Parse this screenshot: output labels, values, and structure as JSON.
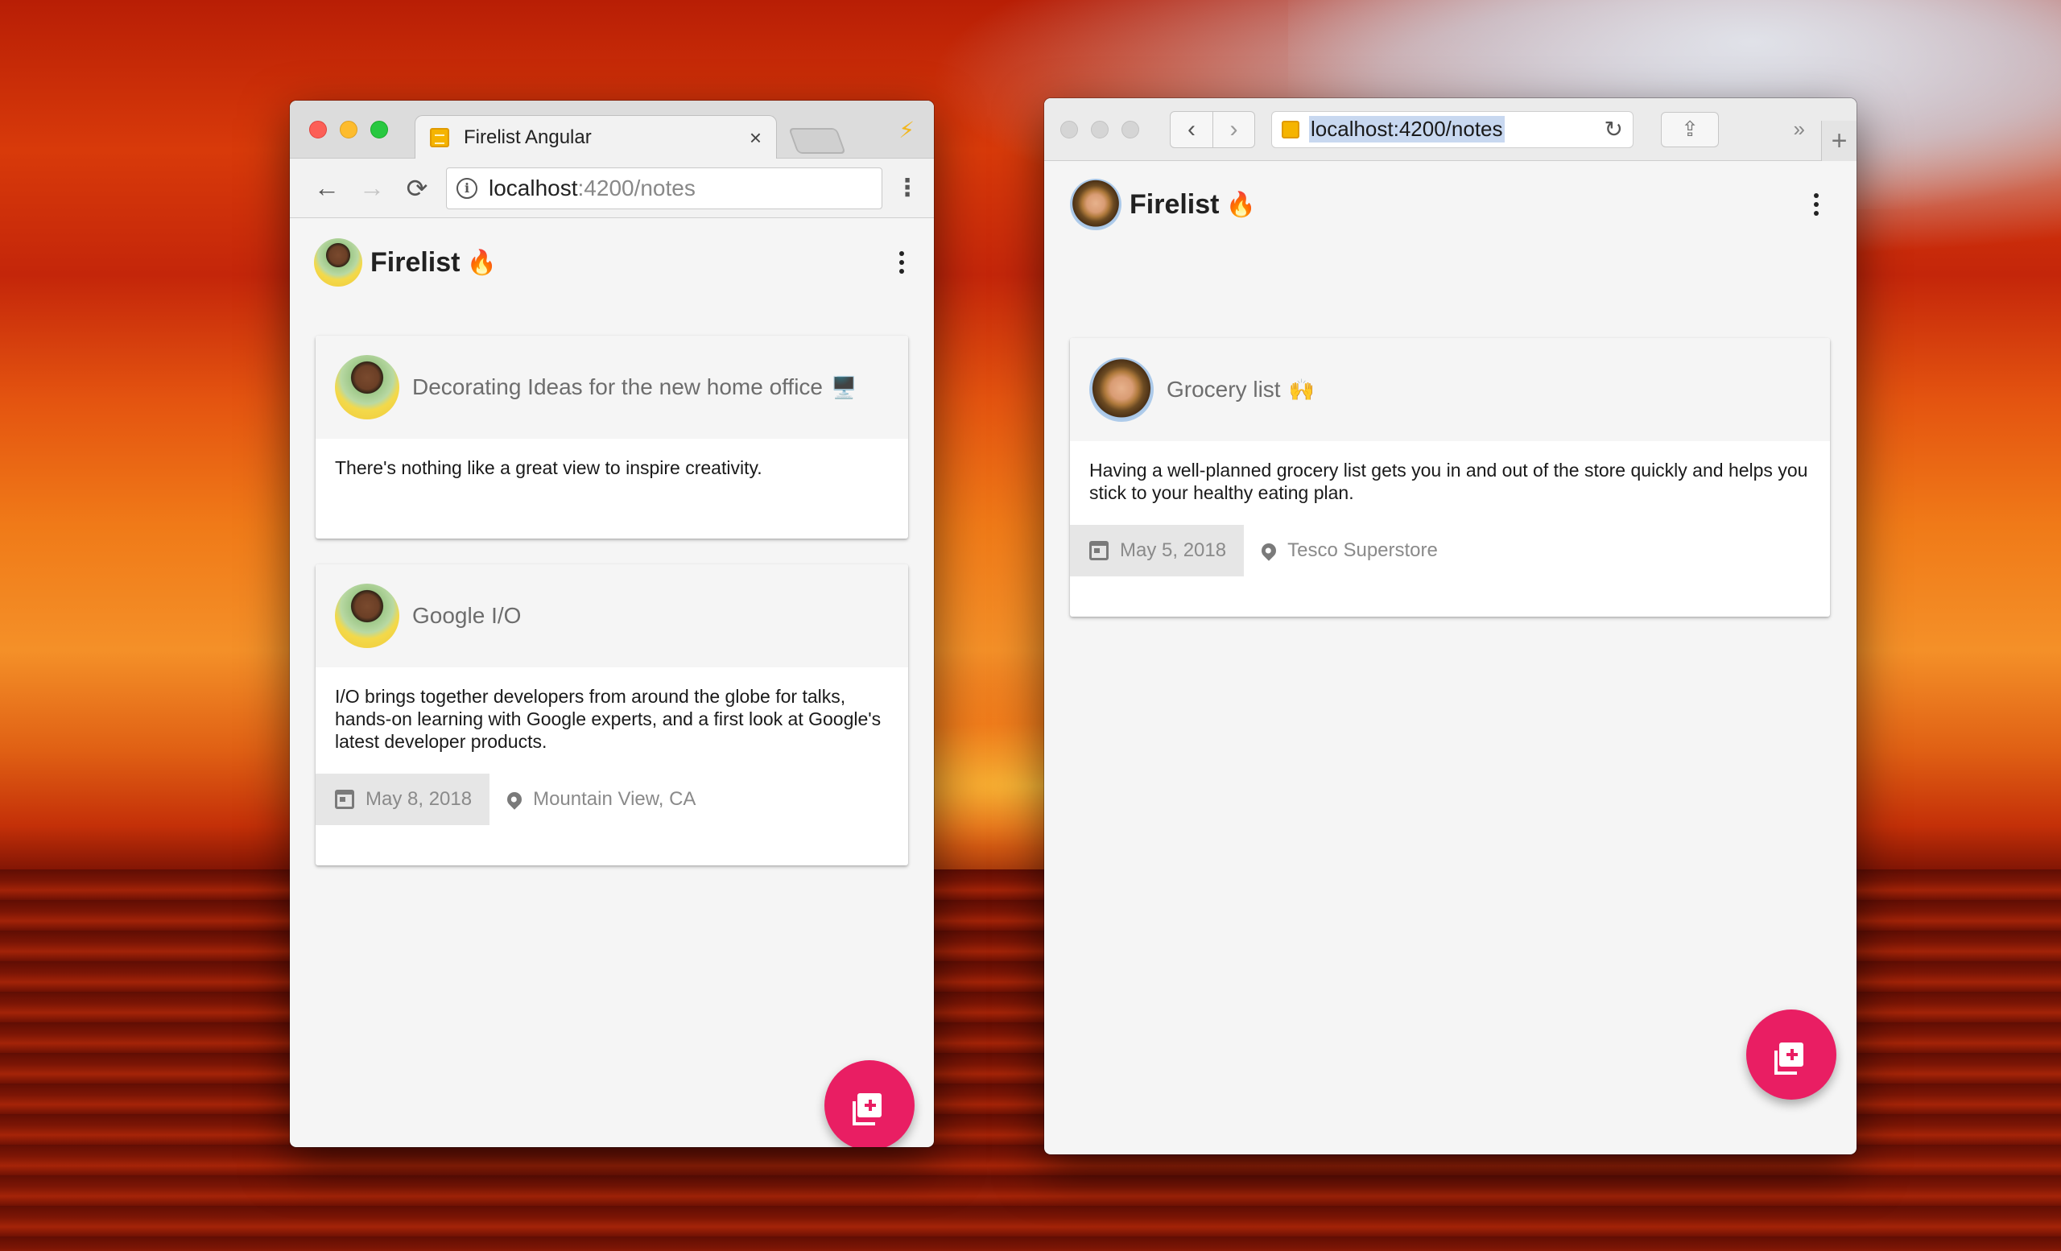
{
  "desktop": {
    "wallpaper": "sunset-over-sea"
  },
  "left_window": {
    "tab": {
      "title": "Firelist Angular",
      "close": "×"
    },
    "toolbar": {
      "back": "←",
      "forward": "→",
      "reload": "⟳",
      "info": "i",
      "url_host": "localhost",
      "url_path": ":4200/notes",
      "menu": "⋮"
    },
    "app": {
      "title": "Firelist",
      "title_emoji": "🔥",
      "notes": [
        {
          "title": "Decorating Ideas for the new home office",
          "emoji": "🖥️",
          "body": "There's nothing like a great view to inspire creativity."
        },
        {
          "title": "Google I/O",
          "emoji": "",
          "body": "I/O brings together developers from around the globe for talks, hands-on learning with Google experts, and a first look at Google's latest developer products.",
          "date": "May 8, 2018",
          "location": "Mountain View, CA"
        }
      ]
    }
  },
  "right_window": {
    "toolbar": {
      "back": "‹",
      "forward": "›",
      "url": "localhost:4200/notes",
      "reload": "↻",
      "share": "⇪",
      "more": "»",
      "new_tab": "+"
    },
    "app": {
      "title": "Firelist",
      "title_emoji": "🔥",
      "notes": [
        {
          "title": "Grocery list",
          "emoji": "🙌",
          "body": "Having a well-planned grocery list gets you in and out of the store quickly and helps you stick to your healthy eating plan.",
          "date": "May 5, 2018",
          "location": "Tesco Superstore"
        }
      ]
    }
  },
  "colors": {
    "fab": "#e91e63",
    "card_header": "#f5f5f5",
    "meta_date_bg": "#e6e6e6"
  },
  "icons": [
    "bolt-icon",
    "info-icon",
    "flame-icon",
    "calendar-icon",
    "location-pin-icon",
    "add-note-icon",
    "share-icon",
    "reload-icon"
  ]
}
